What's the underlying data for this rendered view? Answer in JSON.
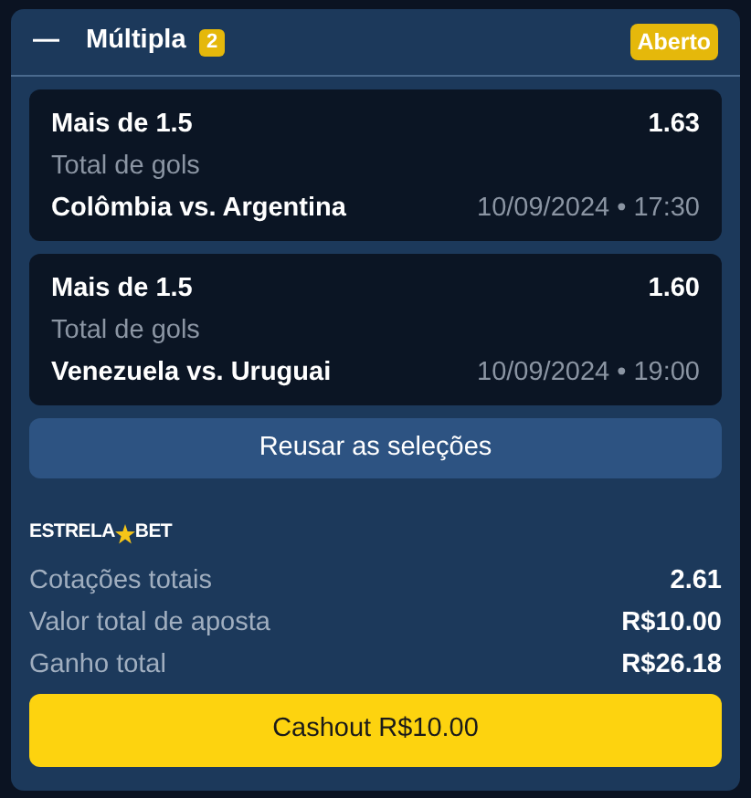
{
  "header": {
    "collapse_icon": "—",
    "title": "Múltipla",
    "count": "2",
    "status": "Aberto"
  },
  "selections": [
    {
      "market_value": "Mais de 1.5",
      "odds": "1.63",
      "market": "Total de gols",
      "match": "Colômbia vs. Argentina",
      "datetime": "10/09/2024 • 17:30"
    },
    {
      "market_value": "Mais de 1.5",
      "odds": "1.60",
      "market": "Total de gols",
      "match": "Venezuela vs. Uruguai",
      "datetime": "10/09/2024 • 19:00"
    }
  ],
  "reuse_button": "Reusar as seleções",
  "logo": {
    "left": "ESTRELA",
    "right": "BET"
  },
  "summary": [
    {
      "label": "Cotações totais",
      "value": "2.61"
    },
    {
      "label": "Valor total de aposta",
      "value": "R$10.00"
    },
    {
      "label": "Ganho total",
      "value": "R$26.18"
    }
  ],
  "cashout_button": "Cashout R$10.00"
}
